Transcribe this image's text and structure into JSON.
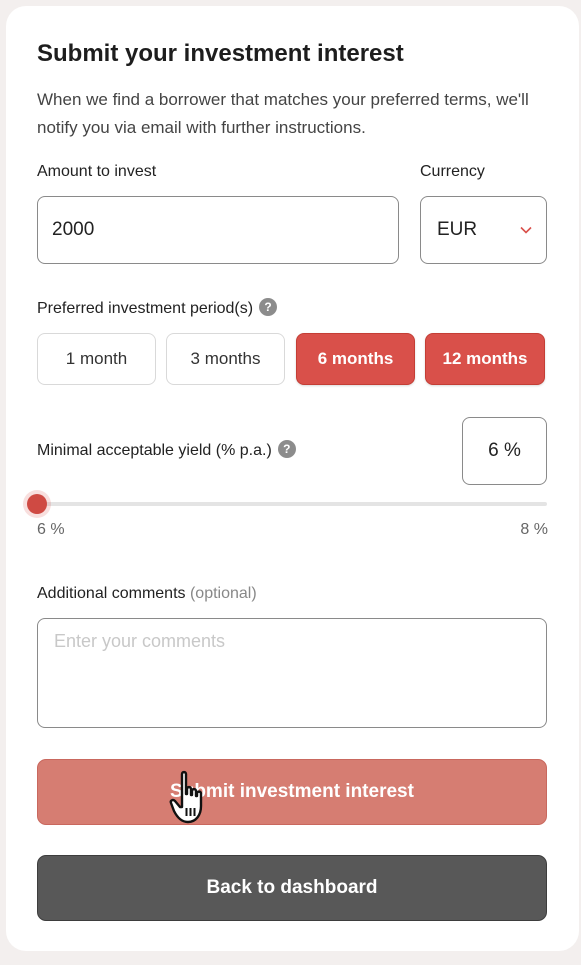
{
  "form": {
    "title": "Submit your investment interest",
    "description": "When we find a borrower that matches your preferred terms, we'll notify you via email with further instructions."
  },
  "amount": {
    "label": "Amount to invest",
    "value": "2000"
  },
  "currency": {
    "label": "Currency",
    "selected": "EUR",
    "icon": "chevron-down-icon"
  },
  "period": {
    "label": "Preferred investment period(s)",
    "help_icon": "?",
    "options": [
      {
        "label": "1 month",
        "selected": false
      },
      {
        "label": "3 months",
        "selected": false
      },
      {
        "label": "6 months",
        "selected": true
      },
      {
        "label": "12 months",
        "selected": true
      }
    ]
  },
  "yield": {
    "label": "Minimal acceptable yield (% p.a.)",
    "help_icon": "?",
    "value_display": "6 %",
    "min_label": "6 %",
    "max_label": "8 %",
    "value": 6,
    "min": 6,
    "max": 8
  },
  "comments": {
    "label": "Additional comments",
    "optional": "(optional)",
    "placeholder": "Enter your comments",
    "value": ""
  },
  "actions": {
    "submit_label": "Submit investment interest",
    "back_label": "Back to dashboard"
  },
  "colors": {
    "accent": "#d9504a",
    "submit_bg": "#d67d72",
    "back_bg": "#585858"
  }
}
